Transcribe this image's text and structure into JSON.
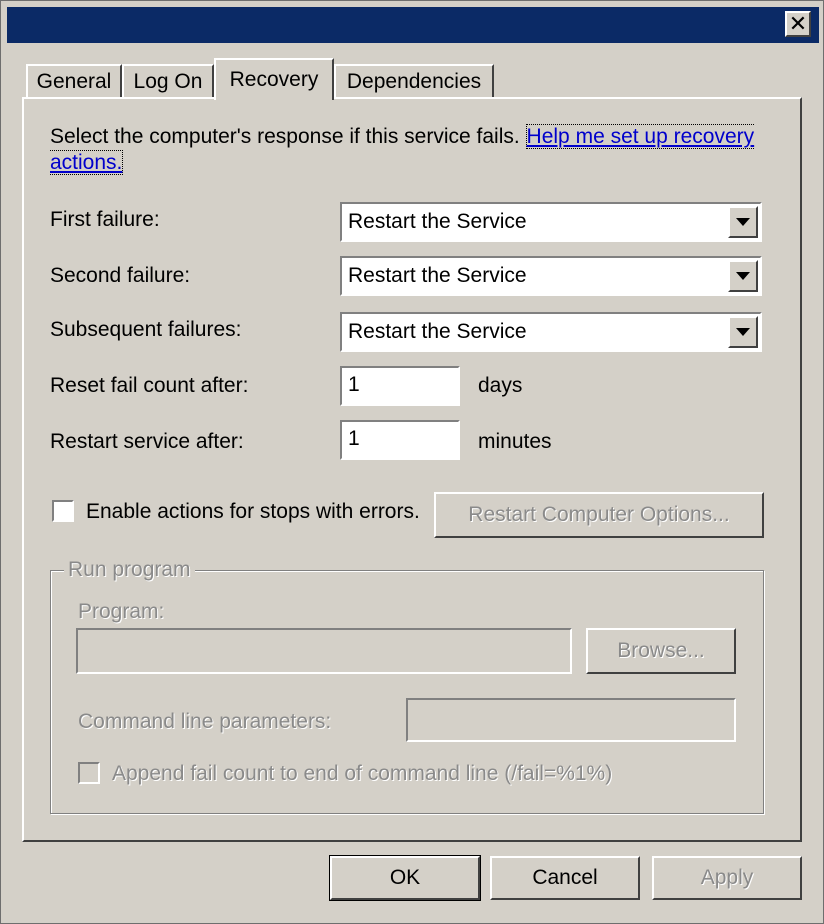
{
  "window": {
    "close_glyph": "✕"
  },
  "tabs": [
    {
      "label": "General",
      "active": false
    },
    {
      "label": "Log On",
      "active": false
    },
    {
      "label": "Recovery",
      "active": true
    },
    {
      "label": "Dependencies",
      "active": false
    }
  ],
  "recovery": {
    "intro_text": "Select the computer's response if this service fails. ",
    "help_link": "Help me set up recovery actions.",
    "first_failure": {
      "label": "First failure:",
      "value": "Restart the Service"
    },
    "second_failure": {
      "label": "Second failure:",
      "value": "Restart the Service"
    },
    "subsequent_failures": {
      "label": "Subsequent failures:",
      "value": "Restart the Service"
    },
    "reset_fail_count": {
      "label": "Reset fail count after:",
      "value": "1",
      "unit": "days"
    },
    "restart_service": {
      "label": "Restart service after:",
      "value": "1",
      "unit": "minutes"
    },
    "enable_actions": {
      "label": "Enable actions for stops with errors.",
      "checked": false
    },
    "restart_computer_button": "Restart Computer Options...",
    "run_program": {
      "title": "Run program",
      "program_label": "Program:",
      "program_value": "",
      "browse_button": "Browse...",
      "params_label": "Command line parameters:",
      "params_value": "",
      "append_label": "Append fail count to end of command line (/fail=%1%)",
      "append_checked": false
    }
  },
  "footer": {
    "ok": "OK",
    "cancel": "Cancel",
    "apply": "Apply"
  }
}
